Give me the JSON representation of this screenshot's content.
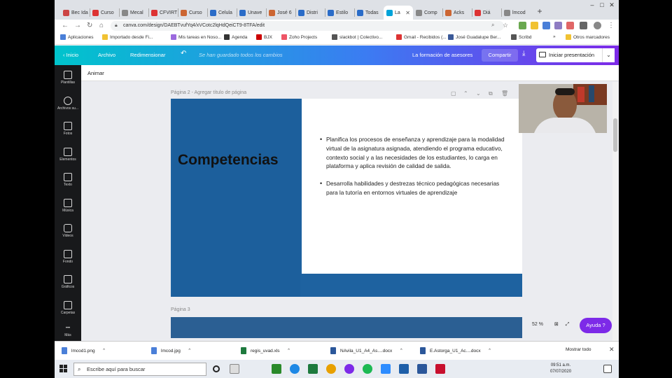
{
  "browser": {
    "tabs": [
      {
        "label": "Bec Ida",
        "color": "#c44"
      },
      {
        "label": "Curso",
        "color": "#d33"
      },
      {
        "label": "Mecal",
        "color": "#888"
      },
      {
        "label": "CFVIRT",
        "color": "#d33"
      },
      {
        "label": "Curso",
        "color": "#c63"
      },
      {
        "label": "Celula",
        "color": "#2a6cc8"
      },
      {
        "label": "Unave",
        "color": "#2a6cc8"
      },
      {
        "label": "José 6",
        "color": "#c63"
      },
      {
        "label": "Distri",
        "color": "#2a6cc8"
      },
      {
        "label": "Estilo",
        "color": "#2a6cc8"
      },
      {
        "label": "Todas",
        "color": "#2a6cc8"
      },
      {
        "label": "La",
        "color": "#00a3d9",
        "active": true
      },
      {
        "label": "Comp",
        "color": "#888"
      },
      {
        "label": "Acks",
        "color": "#c63"
      },
      {
        "label": "Diá",
        "color": "#d33"
      },
      {
        "label": "lmcod",
        "color": "#888"
      }
    ],
    "new_tab": "+",
    "url": "canva.com/design/DAEBTvufYq4/xVCotc2lqHdQeiCT9-8TFA/edit",
    "window_controls": [
      "–",
      "□",
      "✕"
    ],
    "bookmarks": [
      {
        "label": "Aplicaciones",
        "color": "#4a7fd8"
      },
      {
        "label": "Importado desde Fi...",
        "color": "#f1c232"
      },
      {
        "label": "Mis tareas en Noso...",
        "color": "#9c6ade"
      },
      {
        "label": "Agenda",
        "color": "#333"
      },
      {
        "label": "BJX",
        "color": "#c00"
      },
      {
        "label": "Zoho Projects",
        "color": "#e56"
      },
      {
        "label": "slackbot | Colectivo...",
        "color": "#555"
      },
      {
        "label": "Gmail - Recibidos (...",
        "color": "#d33"
      },
      {
        "label": "José Guadalupe Ber...",
        "color": "#3b5998"
      },
      {
        "label": "Scribd",
        "color": "#555"
      },
      {
        "label": "»",
        "color": "#fff"
      },
      {
        "label": "Otros marcadores",
        "color": "#f1c232"
      }
    ]
  },
  "canva": {
    "header": {
      "home": "Inicio",
      "file": "Archivo",
      "resize": "Redimensionar",
      "undo_icon": "↶",
      "save_status": "Se han guardado todos los cambios",
      "design_title": "La formación de asesores",
      "share": "Compartir",
      "download_icon": "⤓",
      "present": "Iniciar presentación",
      "more": "⌄"
    },
    "sidebar": [
      {
        "label": "Plantillas",
        "name": "templates"
      },
      {
        "label": "Archivos su...",
        "name": "uploads"
      },
      {
        "label": "Fotos",
        "name": "photos"
      },
      {
        "label": "Elementos",
        "name": "elements"
      },
      {
        "label": "Texto",
        "name": "text"
      },
      {
        "label": "Música",
        "name": "music"
      },
      {
        "label": "Videos",
        "name": "videos"
      },
      {
        "label": "Fondo",
        "name": "background"
      },
      {
        "label": "Gráficos",
        "name": "charts"
      },
      {
        "label": "Carpetas",
        "name": "folders"
      },
      {
        "label": "Más",
        "name": "more"
      }
    ],
    "animate": "Animar",
    "page2_label": "Página 2 - Agregar título de página",
    "page3_label": "Página 3",
    "slide": {
      "title": "Competencias",
      "bullets": [
        "Planifica los procesos de enseñanza y aprendizaje para la modalidad virtual de la asignatura asignada, atendiendo el programa educativo, contexto social y a las necesidades de los estudiantes, lo carga en plataforma y aplica revisión de calidad de salida.",
        "Desarrolla habilidades y destrezas técnico pedagógicas necesarias para la tutoría en entornos virtuales de aprendizaje"
      ]
    },
    "zoom": "52 %",
    "help": "Ayuda ?"
  },
  "downloads": {
    "items": [
      {
        "label": "lmcod1.png",
        "color": "#4a7fd8"
      },
      {
        "label": "lmcod.jpg",
        "color": "#4a7fd8"
      },
      {
        "label": "regis_uvad.xls",
        "color": "#1e7a3e"
      },
      {
        "label": "NAvila_U1_A4_As....docx",
        "color": "#2b579a"
      },
      {
        "label": "E.Astorga_U1_Ac....docx",
        "color": "#2b579a"
      }
    ],
    "show_all": "Mostrar todo",
    "close": "✕"
  },
  "taskbar": {
    "search_placeholder": "Escribe aquí para buscar",
    "time": "09:51 a.m.",
    "date": "07/07/2020"
  }
}
